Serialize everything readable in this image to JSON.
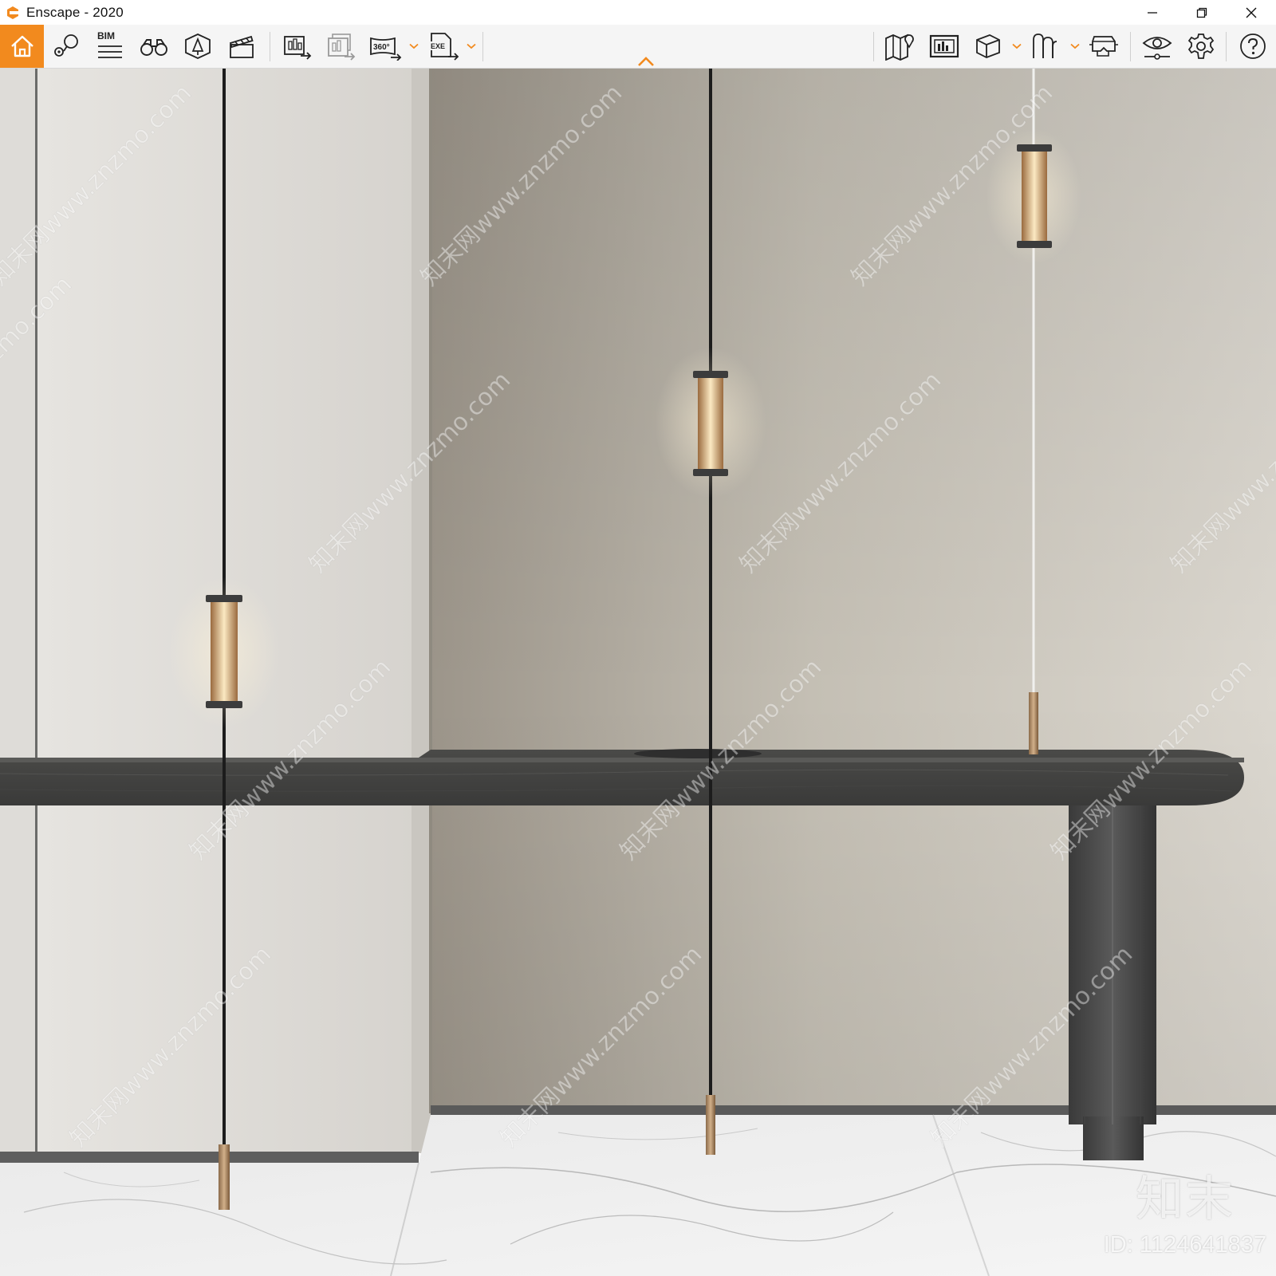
{
  "window": {
    "title": "Enscape - 2020",
    "minimize_icon": "minimize-icon",
    "restore_icon": "restore-icon",
    "close_icon": "close-icon"
  },
  "toolbar": {
    "accent_color": "#f28a1e",
    "bim_label": "BIM",
    "badge_360": "360°",
    "badge_exe": "EXE",
    "left_group": [
      "home-icon",
      "views-icon",
      "bim-icon",
      "binoculars-icon",
      "asset-library-icon",
      "video-editor-icon"
    ],
    "export_group": [
      "screenshot-export-icon",
      "batch-render-icon",
      "panorama-360-icon",
      "exe-export-icon"
    ],
    "right_group": [
      "map-icon",
      "screenshot-icon",
      "cube-icon",
      "ruler-icon",
      "vr-headset-icon",
      "visual-settings-icon",
      "settings-icon",
      "help-icon"
    ]
  },
  "viewport": {
    "scene": "render-viewport",
    "watermark_logo": "知末",
    "watermark_id": "ID: 1124641837",
    "watermark_text": "知末网www.znzmo.com"
  }
}
